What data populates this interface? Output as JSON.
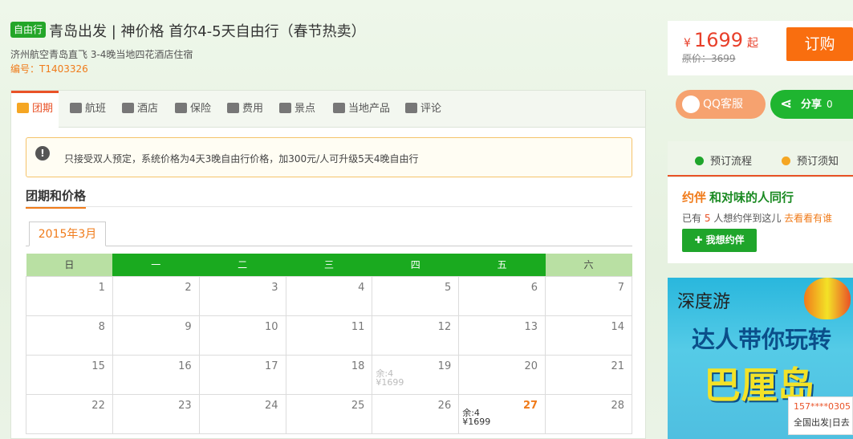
{
  "header": {
    "tag": "自由行",
    "title": "青岛出发 | 神价格 首尔4-5天自由行（春节热卖）",
    "subtitle": "济州航空青岛直飞 3-4晚当地四花酒店住宿",
    "code": "编号：T1403326"
  },
  "pricebox": {
    "currency": "¥",
    "price": "1699",
    "suffix": "起",
    "original": "原价：3699",
    "order_label": "订购"
  },
  "tabs": [
    {
      "label": "团期",
      "icon": "calendar-icon"
    },
    {
      "label": "航班",
      "icon": "plane-icon"
    },
    {
      "label": "酒店",
      "icon": "bed-icon"
    },
    {
      "label": "保险",
      "icon": "shield-icon"
    },
    {
      "label": "费用",
      "icon": "wallet-icon"
    },
    {
      "label": "景点",
      "icon": "pin-icon"
    },
    {
      "label": "当地产品",
      "icon": "location-icon"
    },
    {
      "label": "评论",
      "icon": "comment-icon"
    }
  ],
  "notice": {
    "text": "只接受双人预定，系统价格为4天3晚自由行价格，加300元/人可升级5天4晚自由行"
  },
  "section": {
    "title": "团期和价格",
    "month": "2015年3月"
  },
  "calendar": {
    "weekdays": [
      "日",
      "一",
      "二",
      "三",
      "四",
      "五",
      "六"
    ],
    "rows": [
      [
        {
          "d": "1"
        },
        {
          "d": "2"
        },
        {
          "d": "3"
        },
        {
          "d": "4"
        },
        {
          "d": "5"
        },
        {
          "d": "6"
        },
        {
          "d": "7"
        }
      ],
      [
        {
          "d": "8"
        },
        {
          "d": "9"
        },
        {
          "d": "10"
        },
        {
          "d": "11"
        },
        {
          "d": "12"
        },
        {
          "d": "13"
        },
        {
          "d": "14"
        }
      ],
      [
        {
          "d": "15"
        },
        {
          "d": "16"
        },
        {
          "d": "17"
        },
        {
          "d": "18"
        },
        {
          "d": "19",
          "rem": "余:4",
          "price": "¥1699"
        },
        {
          "d": "20"
        },
        {
          "d": "21"
        }
      ],
      [
        {
          "d": "22"
        },
        {
          "d": "23"
        },
        {
          "d": "24"
        },
        {
          "d": "25"
        },
        {
          "d": "26"
        },
        {
          "d": "27",
          "rem": "余:4",
          "price": "¥1699",
          "hl": true
        },
        {
          "d": "28"
        }
      ]
    ]
  },
  "side": {
    "qq_label": "QQ客服",
    "share_label": "分享",
    "share_count": "0",
    "flow_label": "预订流程",
    "notice_label": "预订须知",
    "yueban_logo": "约伴",
    "yueban_title": "和对味的人同行",
    "yueban_pre": "已有",
    "yueban_count": "5",
    "yueban_post": "人想约伴到这儿",
    "yueban_link": "去看看有谁",
    "yueban_btn": "我想约伴"
  },
  "ad": {
    "brand": "深度游",
    "slogan": "达人带你玩转",
    "big": "巴厘岛",
    "tip_phone": "157****0305",
    "tip_text": "全国出发|日去"
  },
  "colors": {
    "green": "#1aaa1f",
    "orange": "#f96e0f",
    "red": "#e8402b"
  }
}
